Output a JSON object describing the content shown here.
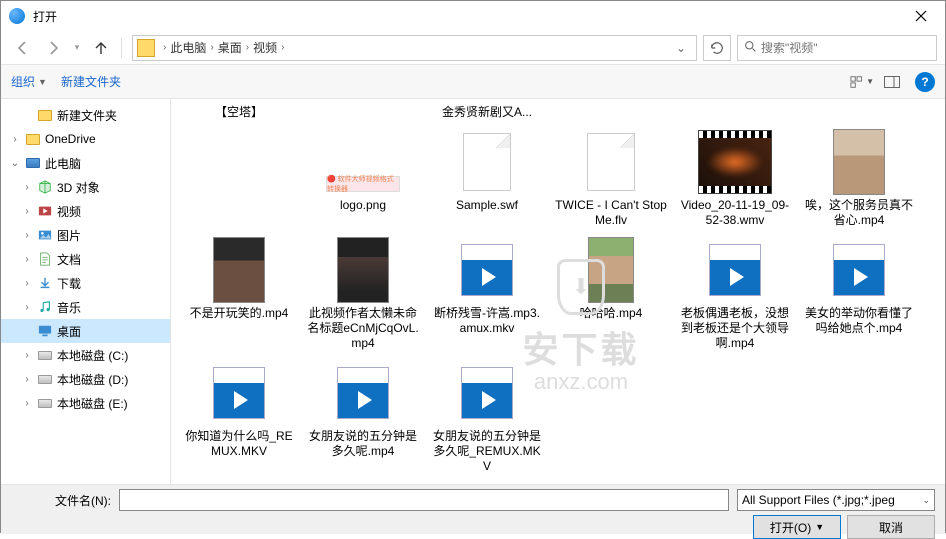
{
  "title": "打开",
  "breadcrumb": [
    "此电脑",
    "桌面",
    "视频"
  ],
  "search_placeholder": "搜索\"视频\"",
  "toolbar": {
    "organize": "组织",
    "new_folder": "新建文件夹"
  },
  "sidebar": [
    {
      "label": "新建文件夹",
      "icon": "folder",
      "indent": 1,
      "exp": "none"
    },
    {
      "label": "OneDrive",
      "icon": "folder",
      "indent": 0,
      "exp": "closed"
    },
    {
      "label": "此电脑",
      "icon": "pc",
      "indent": 0,
      "exp": "open"
    },
    {
      "label": "3D 对象",
      "icon": "3d",
      "indent": 1,
      "exp": "closed",
      "color": "#3ab54a"
    },
    {
      "label": "视频",
      "icon": "video",
      "indent": 1,
      "exp": "closed",
      "color": "#b44"
    },
    {
      "label": "图片",
      "icon": "images",
      "indent": 1,
      "exp": "closed",
      "color": "#3a8dd0"
    },
    {
      "label": "文档",
      "icon": "docs",
      "indent": 1,
      "exp": "closed",
      "color": "#6a6"
    },
    {
      "label": "下载",
      "icon": "download",
      "indent": 1,
      "exp": "closed",
      "color": "#3a8dd0"
    },
    {
      "label": "音乐",
      "icon": "music",
      "indent": 1,
      "exp": "closed",
      "color": "#2aa"
    },
    {
      "label": "桌面",
      "icon": "desktop",
      "indent": 1,
      "exp": "none",
      "color": "#3a8dd0",
      "selected": true
    },
    {
      "label": "本地磁盘 (C:)",
      "icon": "disk",
      "indent": 1,
      "exp": "closed"
    },
    {
      "label": "本地磁盘 (D:)",
      "icon": "disk",
      "indent": 1,
      "exp": "closed"
    },
    {
      "label": "本地磁盘 (E:)",
      "icon": "disk",
      "indent": 1,
      "exp": "closed"
    }
  ],
  "files_row0": [
    {
      "name": "【空塔】",
      "thumb": "none"
    },
    {
      "name": "",
      "thumb": "none",
      "hidden": true
    },
    {
      "name": "金秀贤新剧又A...",
      "thumb": "none"
    }
  ],
  "files": [
    {
      "name": "logo.png",
      "thumb": "logo"
    },
    {
      "name": "Sample.swf",
      "thumb": "page"
    },
    {
      "name": "TWICE - I Can't Stop Me.flv",
      "thumb": "page"
    },
    {
      "name": "Video_20-11-19_09-52-38.wmv",
      "thumb": "wmv"
    },
    {
      "name": "唉，这个服务员真不省心.mp4",
      "thumb": "photo-v1"
    },
    {
      "name": "不是开玩笑的.mp4",
      "thumb": "photo-v2"
    },
    {
      "name": "此视频作者太懒未命名标题eCnMjCqOvL.mp4",
      "thumb": "photo-v3"
    },
    {
      "name": "断桥残雪-许嵩.mp3.amux.mkv",
      "thumb": "video"
    },
    {
      "name": "哈哈哈.mp4",
      "thumb": "haha"
    },
    {
      "name": "老板偶遇老板，没想到老板还是个大领导啊.mp4",
      "thumb": "video"
    },
    {
      "name": "美女的举动你看懂了吗给她点个.mp4",
      "thumb": "video"
    },
    {
      "name": "你知道为什么吗_REMUX.MKV",
      "thumb": "video"
    },
    {
      "name": "女朋友说的五分钟是多久呢.mp4",
      "thumb": "video"
    },
    {
      "name": "女朋友说的五分钟是多久呢_REMUX.MKV",
      "thumb": "video"
    }
  ],
  "footer": {
    "filename_label": "文件名(N):",
    "filename_value": "",
    "filter": "All Support Files (*.jpg;*.jpeg",
    "open": "打开(O)",
    "cancel": "取消"
  },
  "watermark": {
    "main": "安下载",
    "sub": "anxz.com"
  }
}
